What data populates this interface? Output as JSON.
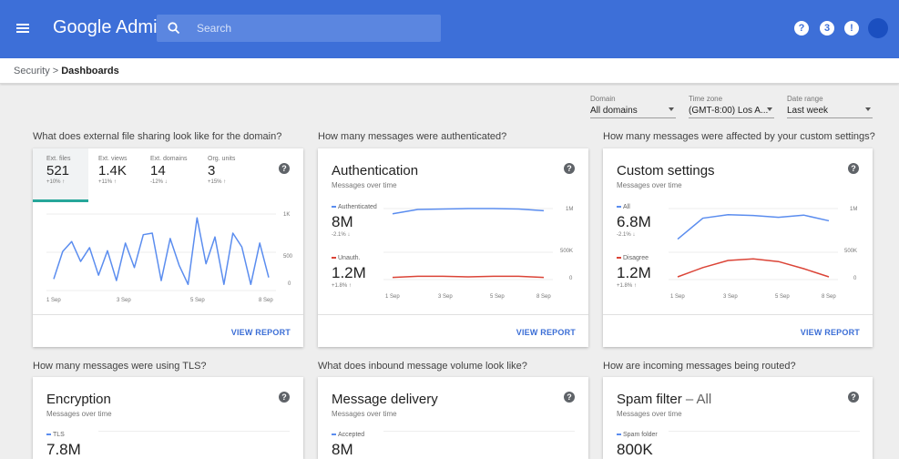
{
  "app": {
    "brand": "Google Admin"
  },
  "search": {
    "placeholder": "Search"
  },
  "topbar": {
    "help_glyph": "?",
    "apps_glyph": "3",
    "notif_glyph": "!"
  },
  "breadcrumb": {
    "parent": "Security",
    "separator": ">",
    "current": "Dashboards"
  },
  "filters": {
    "domain": {
      "label": "Domain",
      "value": "All domains"
    },
    "timezone": {
      "label": "Time zone",
      "value": "(GMT-8:00) Los A..."
    },
    "daterange": {
      "label": "Date range",
      "value": "Last week"
    }
  },
  "help_glyph": "?",
  "view_report": "VIEW REPORT",
  "sharing": {
    "question": "What does external file sharing look like for the domain?",
    "stats": [
      {
        "label": "Ext. files",
        "value": "521",
        "change": "+10% ↑"
      },
      {
        "label": "Ext. views",
        "value": "1.4K",
        "change": "+11% ↑"
      },
      {
        "label": "Ext. domains",
        "value": "14",
        "change": "-12% ↓"
      },
      {
        "label": "Org. units",
        "value": "3",
        "change": "+15% ↑"
      }
    ],
    "y_ticks": [
      "1K",
      "500",
      "0"
    ],
    "x_ticks": [
      "1 Sep",
      "3 Sep",
      "5 Sep",
      "8 Sep"
    ],
    "series": [
      150,
      510,
      640,
      380,
      560,
      200,
      520,
      130,
      620,
      300,
      730,
      750,
      130,
      680,
      330,
      80,
      950,
      350,
      700,
      80,
      750,
      570,
      80,
      620,
      170
    ]
  },
  "auth": {
    "question": "How many messages were authenticated?",
    "title": "Authentication",
    "subtitle": "Messages over time",
    "s1_name": "Authenticated",
    "s1_value": "8M",
    "s1_change": "-2.1% ↓",
    "s2_name": "Unauth.",
    "s2_value": "1.2M",
    "s2_change": "+1.8% ↑",
    "top_ticks": [
      "1M",
      "500K"
    ],
    "bottom_ticks": [
      "0"
    ],
    "x_ticks": [
      "1 Sep",
      "3 Sep",
      "5 Sep",
      "8 Sep"
    ],
    "s1_series": [
      0.88,
      0.98,
      0.99,
      1.0,
      1.0,
      0.99,
      0.95
    ],
    "s2_series": [
      0.04,
      0.06,
      0.06,
      0.05,
      0.06,
      0.06,
      0.04
    ]
  },
  "custom": {
    "question": "How many messages were affected by your custom settings?",
    "title": "Custom settings",
    "subtitle": "Messages over time",
    "s1_name": "All",
    "s1_value": "6.8M",
    "s1_change": "-2.1% ↓",
    "s2_name": "Disagree",
    "s2_value": "1.2M",
    "s2_change": "+1.8% ↑",
    "top_ticks": [
      "1M",
      "500K"
    ],
    "bottom_ticks": [
      "0"
    ],
    "x_ticks": [
      "1 Sep",
      "3 Sep",
      "5 Sep",
      "8 Sep"
    ],
    "s1_series": [
      0.3,
      0.78,
      0.86,
      0.84,
      0.8,
      0.85,
      0.72
    ],
    "s2_series": [
      0.05,
      0.22,
      0.35,
      0.38,
      0.33,
      0.2,
      0.05
    ]
  },
  "tls": {
    "question": "How many messages were using TLS?",
    "title": "Encryption",
    "subtitle": "Messages over time",
    "s1_name": "TLS",
    "s1_value": "7.8M"
  },
  "delivery": {
    "question": "What does inbound message volume look like?",
    "title": "Message delivery",
    "subtitle": "Messages over time",
    "s1_name": "Accepted",
    "s1_value": "8M"
  },
  "spam": {
    "question": "How are incoming messages being routed?",
    "title": "Spam filter",
    "title_suffix": " – All",
    "subtitle": "Messages over time",
    "s1_name": "Spam folder",
    "s1_value": "800K"
  },
  "colors": {
    "blue": "#5b8def",
    "red": "#db4437",
    "teal": "#26a69a",
    "topbar": "#3d6fd8"
  }
}
